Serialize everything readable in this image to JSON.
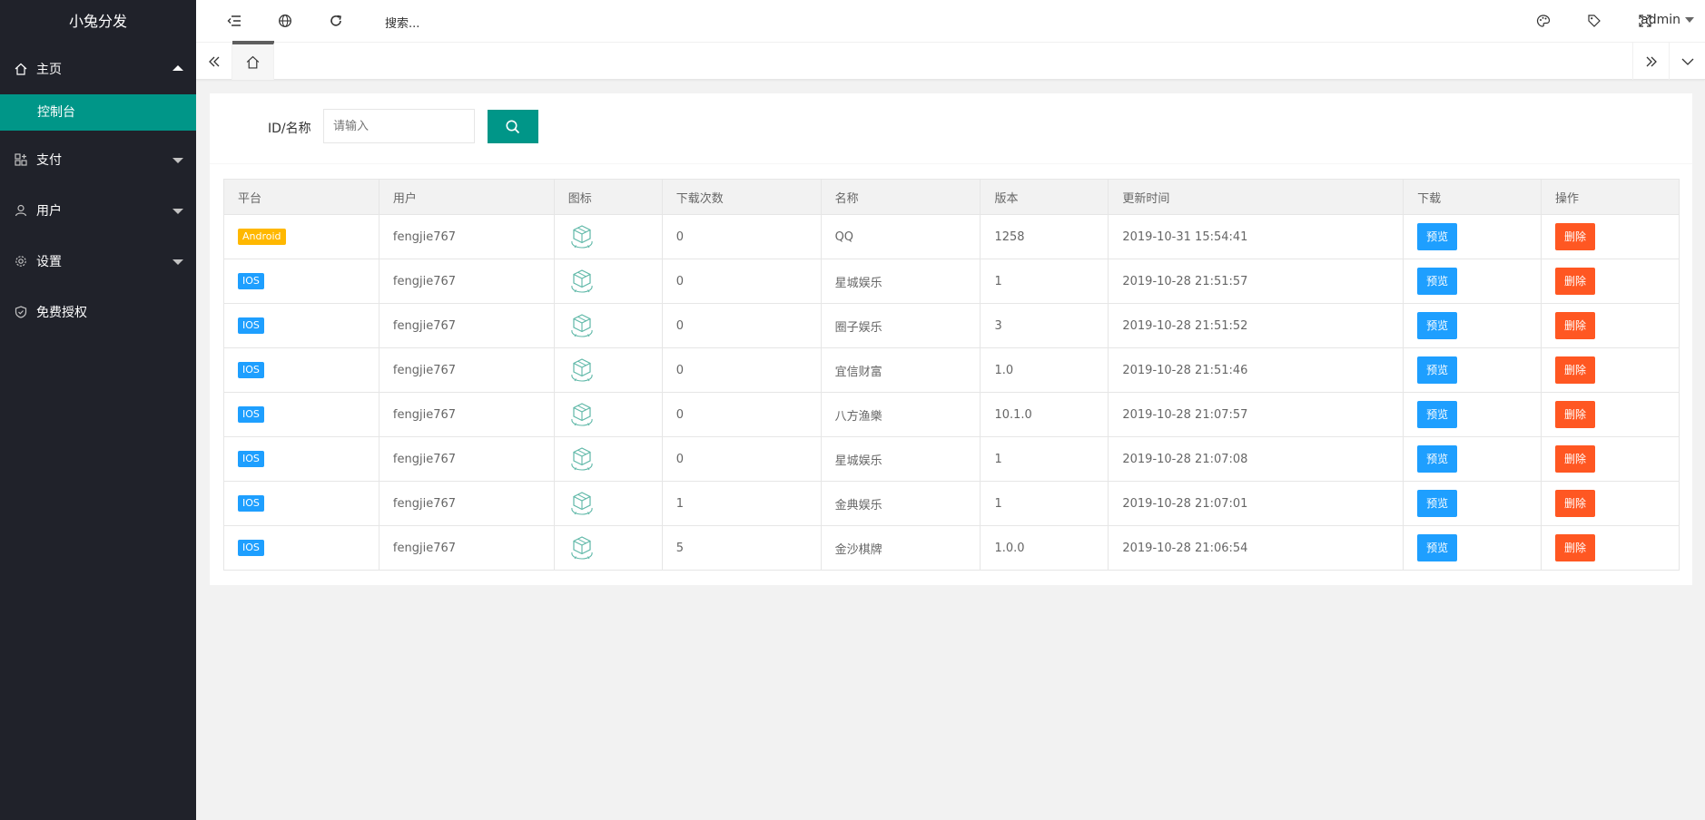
{
  "app": {
    "title": "小兔分发"
  },
  "colors": {
    "sidebar_bg": "#20222a",
    "accent": "#009688",
    "blue": "#1e9fff",
    "red": "#ff5722",
    "android": "#ffb800"
  },
  "sidebar": {
    "items": [
      {
        "label": "主页",
        "icon": "home-icon",
        "expanded": true
      },
      {
        "label": "控制台",
        "active": true
      },
      {
        "label": "支付",
        "icon": "payment-icon",
        "expanded": false
      },
      {
        "label": "用户",
        "icon": "user-icon",
        "expanded": false
      },
      {
        "label": "设置",
        "icon": "gear-icon",
        "expanded": false
      },
      {
        "label": "免费授权",
        "icon": "shield-check-icon"
      }
    ]
  },
  "header": {
    "search_placeholder": "搜索...",
    "user": "admin",
    "icons": [
      "shrink-menu-icon",
      "globe-icon",
      "refresh-icon",
      "palette-icon",
      "tag-icon",
      "fullscreen-icon"
    ]
  },
  "filter": {
    "label": "ID/名称",
    "placeholder": "请输入"
  },
  "table": {
    "columns": [
      "平台",
      "用户",
      "图标",
      "下载次数",
      "名称",
      "版本",
      "更新时间",
      "下载",
      "操作"
    ],
    "preview_label": "预览",
    "delete_label": "删除",
    "rows": [
      {
        "platform": "Android",
        "user": "fengjie767",
        "downloads": "0",
        "name": "QQ",
        "version": "1258",
        "updated": "2019-10-31 15:54:41"
      },
      {
        "platform": "IOS",
        "user": "fengjie767",
        "downloads": "0",
        "name": "星城娱乐",
        "version": "1",
        "updated": "2019-10-28 21:51:57"
      },
      {
        "platform": "IOS",
        "user": "fengjie767",
        "downloads": "0",
        "name": "圈子娱乐",
        "version": "3",
        "updated": "2019-10-28 21:51:52"
      },
      {
        "platform": "IOS",
        "user": "fengjie767",
        "downloads": "0",
        "name": "宜信财富",
        "version": "1.0",
        "updated": "2019-10-28 21:51:46"
      },
      {
        "platform": "IOS",
        "user": "fengjie767",
        "downloads": "0",
        "name": "八方渔樂",
        "version": "10.1.0",
        "updated": "2019-10-28 21:07:57"
      },
      {
        "platform": "IOS",
        "user": "fengjie767",
        "downloads": "0",
        "name": "星城娱乐",
        "version": "1",
        "updated": "2019-10-28 21:07:08"
      },
      {
        "platform": "IOS",
        "user": "fengjie767",
        "downloads": "1",
        "name": "金典娱乐",
        "version": "1",
        "updated": "2019-10-28 21:07:01"
      },
      {
        "platform": "IOS",
        "user": "fengjie767",
        "downloads": "5",
        "name": "金沙棋牌",
        "version": "1.0.0",
        "updated": "2019-10-28 21:06:54"
      }
    ]
  }
}
